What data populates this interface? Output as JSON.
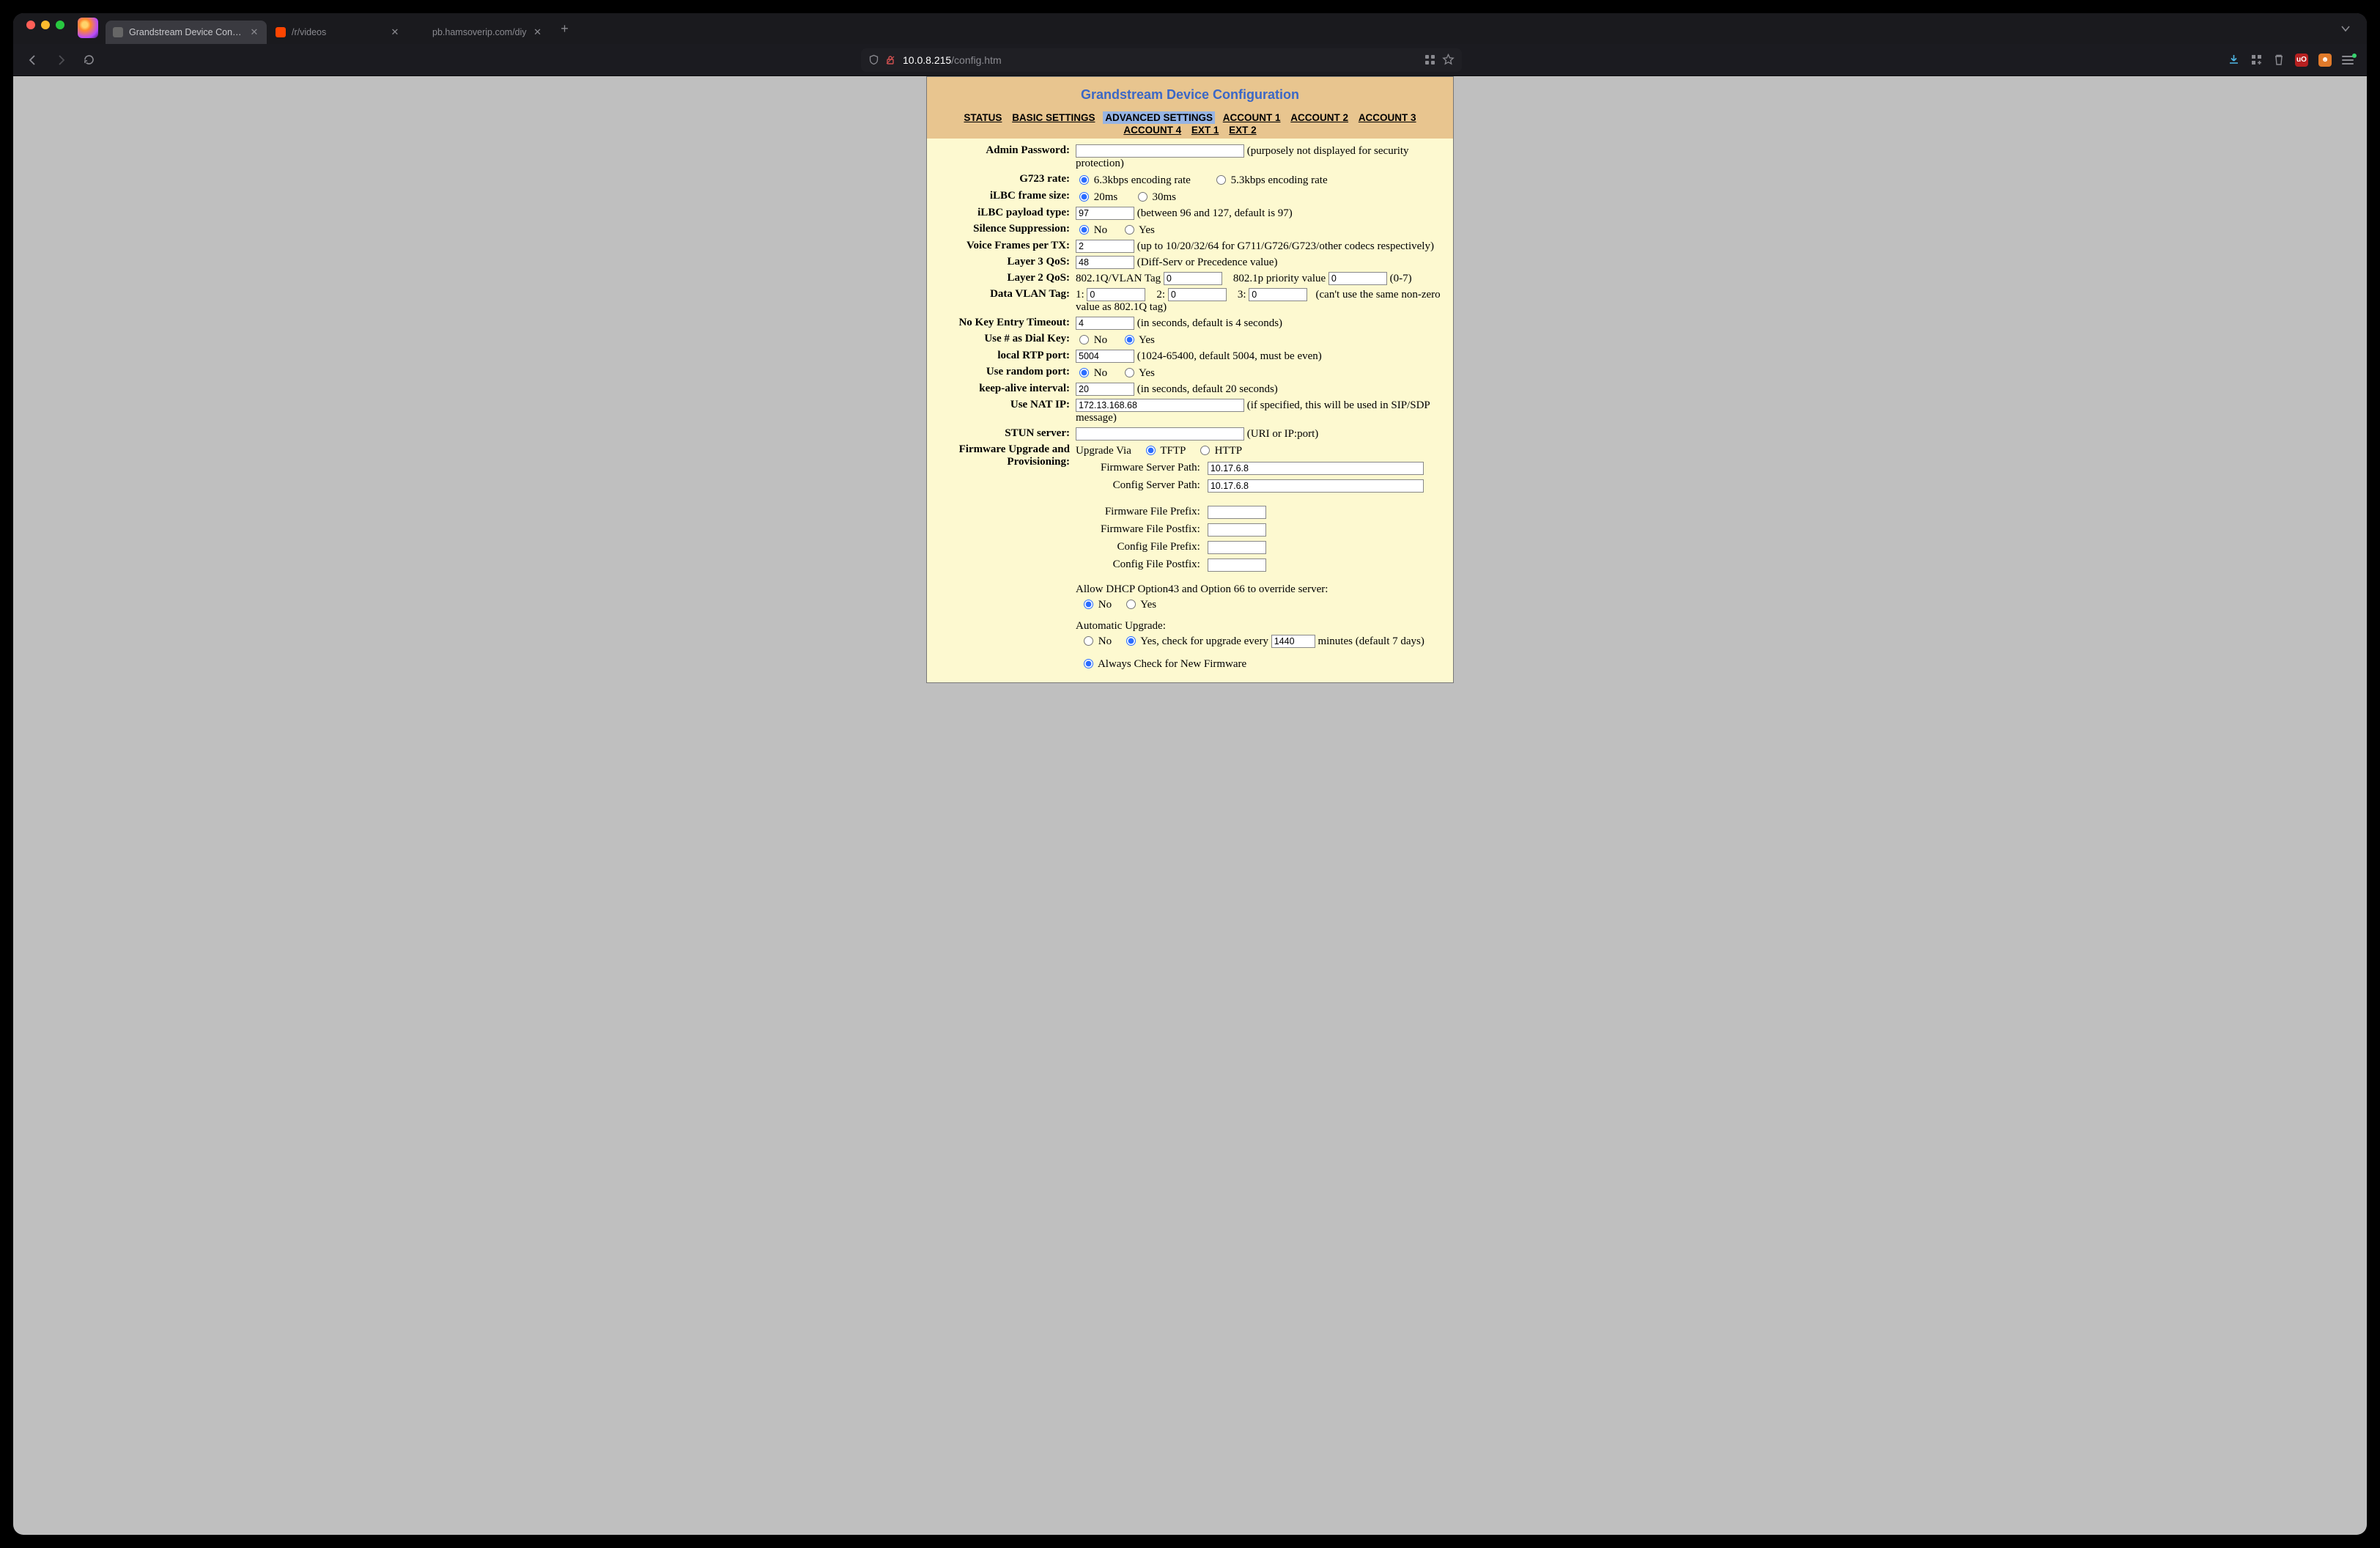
{
  "browser": {
    "tabs": [
      {
        "label": "Grandstream Device Configuration",
        "active": true
      },
      {
        "label": "/r/videos",
        "active": false
      },
      {
        "label": "pb.hamsoverip.com/diy",
        "active": false
      }
    ],
    "url_host": "10.0.8.215",
    "url_path": "/config.htm"
  },
  "page": {
    "title": "Grandstream Device Configuration",
    "nav": [
      "STATUS",
      "BASIC SETTINGS",
      "ADVANCED SETTINGS",
      "ACCOUNT 1",
      "ACCOUNT 2",
      "ACCOUNT 3",
      "ACCOUNT 4",
      "EXT 1",
      "EXT 2"
    ],
    "nav_selected": "ADVANCED SETTINGS"
  },
  "labels": {
    "admin_password": "Admin Password:",
    "admin_password_hint": "(purposely not displayed for security protection)",
    "g723_rate": "G723 rate:",
    "g723_opt_a": "6.3kbps encoding rate",
    "g723_opt_b": "5.3kbps encoding rate",
    "ilbc_frame": "iLBC frame size:",
    "ilbc_20": "20ms",
    "ilbc_30": "30ms",
    "ilbc_payload": "iLBC payload type:",
    "ilbc_payload_hint": "(between 96 and 127, default is 97)",
    "silence_supp": "Silence Suppression:",
    "no": "No",
    "yes": "Yes",
    "voice_frames": "Voice Frames per TX:",
    "voice_frames_hint": "(up to 10/20/32/64 for G711/G726/G723/other codecs respectively)",
    "layer3": "Layer 3 QoS:",
    "layer3_hint": "(Diff-Serv or Precedence value)",
    "layer2": "Layer 2 QoS:",
    "layer2_vlan": "802.1Q/VLAN Tag",
    "layer2_prio": "802.1p priority value",
    "layer2_range": "(0-7)",
    "data_vlan": "Data VLAN Tag:",
    "data_vlan_1": "1:",
    "data_vlan_2": "2:",
    "data_vlan_3": "3:",
    "data_vlan_hint": "(can't use the same non-zero value as 802.1Q tag)",
    "no_key": "No Key Entry Timeout:",
    "no_key_hint": "(in seconds, default is 4 seconds)",
    "hash_dial": "Use # as Dial Key:",
    "rtp_port": "local RTP port:",
    "rtp_port_hint": "(1024-65400, default 5004, must be even)",
    "random_port": "Use random port:",
    "keepalive": "keep-alive interval:",
    "keepalive_hint": "(in seconds, default 20 seconds)",
    "nat_ip": "Use NAT IP:",
    "nat_ip_hint": "(if specified, this will be used in SIP/SDP message)",
    "stun": "STUN server:",
    "stun_hint": "(URI or IP:port)",
    "prov": "Firmware Upgrade and Provisioning:",
    "upgrade_via": "Upgrade Via",
    "tftp": "TFTP",
    "http": "HTTP",
    "fw_server": "Firmware Server Path:",
    "cfg_server": "Config Server Path:",
    "fw_prefix": "Firmware File Prefix:",
    "fw_postfix": "Firmware File Postfix:",
    "cfg_prefix": "Config File Prefix:",
    "cfg_postfix": "Config File Postfix:",
    "dhcp_override": "Allow DHCP Option43 and Option 66 to override server:",
    "auto_upgrade": "Automatic Upgrade:",
    "auto_yes": "Yes, check for upgrade every",
    "auto_minutes": "minutes (default 7 days)",
    "always_check": "Always Check for New Firmware"
  },
  "values": {
    "admin_password": "",
    "g723_rate": "6.3",
    "ilbc_frame": "20",
    "ilbc_payload": "97",
    "silence_suppression": "No",
    "voice_frames": "2",
    "layer3_qos": "48",
    "layer2_vlan": "0",
    "layer2_prio": "0",
    "data_vlan_1": "0",
    "data_vlan_2": "0",
    "data_vlan_3": "0",
    "no_key_timeout": "4",
    "hash_dial": "Yes",
    "rtp_port": "5004",
    "random_port": "No",
    "keepalive": "20",
    "nat_ip": "172.13.168.68",
    "stun": "",
    "upgrade_via": "TFTP",
    "fw_server": "10.17.6.8",
    "cfg_server": "10.17.6.8",
    "fw_prefix": "",
    "fw_postfix": "",
    "cfg_prefix": "",
    "cfg_postfix": "",
    "dhcp_override": "No",
    "auto_upgrade": "Yes",
    "auto_minutes": "1440",
    "fw_check": "always"
  }
}
